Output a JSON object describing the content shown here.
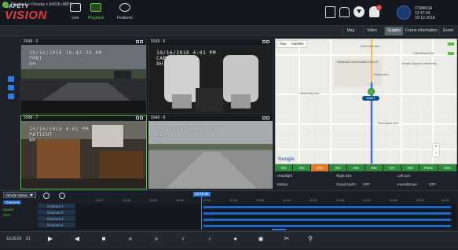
{
  "app": {
    "logo_line1": "SAFETY",
    "logo_line2": "VISION"
  },
  "topnav": [
    {
      "label": "Live"
    },
    {
      "label": "Playback"
    },
    {
      "label": "Features"
    }
  ],
  "user": {
    "name": "ITRMKSA",
    "time": "12:47:34",
    "date": "10-12-2018",
    "notification_count": "3"
  },
  "breadcrumb": "Playback > Driveby > 84628 (4801)",
  "tabs": [
    "Map",
    "Video",
    "Graphs",
    "Frame Information",
    "Event"
  ],
  "active_tab": "Graphs",
  "cameras": [
    {
      "header": "5548 - 5",
      "osd": "10/16/2018 10:42:20 AM\nFRNT\n8H"
    },
    {
      "header": "5548 - 6",
      "osd": "10/16/2018 4:01 PM\nCAB\n8H"
    },
    {
      "header": "5548 - 7",
      "osd": "10/16/2018 4:01 PM\nPATIENT\n8H"
    },
    {
      "header": "5548 - 8",
      "osd": "10/16/2018 4:01 PM\nREAR\n8H"
    }
  ],
  "map": {
    "type_map": "Map",
    "type_sat": "Satellite",
    "zoom_in": "+",
    "zoom_out": "−",
    "google": "Google",
    "vehicle_tag": "84607",
    "labels": [
      {
        "text": "Deerview Ave"
      },
      {
        "text": "Camelback Rd"
      },
      {
        "text": "Unitarian Universalist Church"
      },
      {
        "text": "Grand Canyon University"
      },
      {
        "text": "University Ave"
      },
      {
        "text": "Renegade Ave"
      },
      {
        "text": "Frisco Ave"
      }
    ]
  },
  "io_buttons": [
    "IO1",
    "IO2",
    "IO3",
    "IO4",
    "IO5",
    "IO6",
    "IO7",
    "IO8",
    "Panic",
    "IGN"
  ],
  "io_active": "IO3",
  "status": {
    "headlight_label": "Headlight",
    "headlight_value": "",
    "rightturn_label": "Right turn",
    "rightturn_value": "",
    "leftturn_label": "Left turn",
    "leftturn_value": "",
    "motion_label": "Motion",
    "motion_value": "",
    "grandnorth_label": "Grand North",
    "grandnorth_value": "OFF",
    "investidriver_label": "InvestiDriver",
    "investidriver_value": "OFF"
  },
  "timeline": {
    "vehicle_status": "Vehicle Status",
    "status_items": [
      "Channels",
      "Speed",
      "ACC"
    ],
    "current_time": "10:20:26",
    "ticks": [
      "10:27",
      "10:28",
      "10:29",
      "10:30",
      "10:31",
      "10:32",
      "10:33",
      "10:34",
      "10:35",
      "10:36",
      "10:37",
      "10:38",
      "10:39",
      "10:40"
    ],
    "channels": [
      "Channel 1",
      "Channel 2",
      "Channel 3",
      "Channel 4"
    ]
  },
  "controls": {
    "clock": "10:20:26",
    "speed": "X1"
  }
}
